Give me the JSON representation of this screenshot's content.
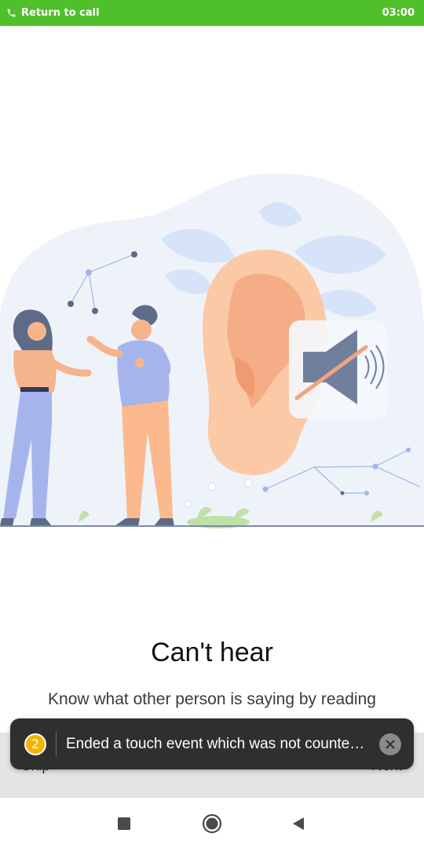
{
  "status_bar": {
    "return_label": "Return to call",
    "timer": "03:00",
    "phone_icon": "phone-icon",
    "color": "#4fc02a"
  },
  "illustration": {
    "name": "two people talking next to large ear with muted speaker"
  },
  "content": {
    "title": "Can't hear",
    "subtitle": "Know what other person is saying by reading"
  },
  "actions": {
    "skip_label": "Skip",
    "next_label": "Next"
  },
  "toast": {
    "count": "2",
    "message": "Ended a touch event which was not counte…",
    "close_icon": "close-icon"
  },
  "nav": {
    "recents_icon": "square-recents-icon",
    "home_icon": "circle-home-icon",
    "back_icon": "triangle-back-icon"
  }
}
